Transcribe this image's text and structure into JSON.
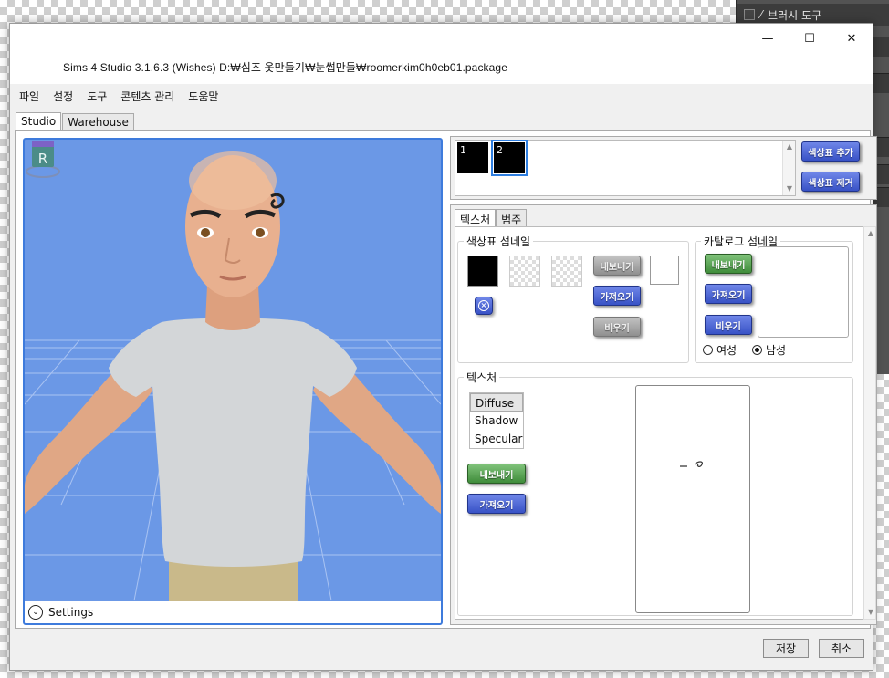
{
  "background_app": {
    "layer_label": "브러시 도구"
  },
  "window": {
    "title": "Sims 4 Studio 3.1.6.3 (Wishes)  D:₩심즈 옷만들기₩눈썹만들₩roomerkim0h0eb01.package",
    "controls": {
      "minimize": "—",
      "maximize": "☐",
      "close": "✕"
    }
  },
  "menu": [
    "파일",
    "설정",
    "도구",
    "콘텐츠 관리",
    "도움말"
  ],
  "top_tabs": [
    "Studio",
    "Warehouse"
  ],
  "viewport": {
    "settings_label": "Settings",
    "badge_letter": "R",
    "background_color": "#6b98e6"
  },
  "swatches": {
    "items": [
      {
        "label": "1"
      },
      {
        "label": "2"
      }
    ],
    "add_button": "색상표 추가",
    "remove_button": "색상표 제거"
  },
  "inner_tabs": [
    "텍스처",
    "범주"
  ],
  "swatch_thumbnail": {
    "title": "색상표 섬네일",
    "export": "내보내기",
    "import": "가져오기",
    "clear": "비우기"
  },
  "catalog_thumbnail": {
    "title": "카탈로그 섬네일",
    "export": "내보내기",
    "import": "가져오기",
    "clear": "비우기",
    "gender_female": "여성",
    "gender_male": "남성"
  },
  "texture": {
    "title": "텍스처",
    "list": [
      "Diffuse",
      "Shadow",
      "Specular"
    ],
    "export": "내보내기",
    "import": "가져오기"
  },
  "footer": {
    "save": "저장",
    "cancel": "취소"
  },
  "colors": {
    "accent_blue": "#3852c6",
    "accent_green": "#3f8c3a",
    "selection": "#2e7ee0"
  }
}
